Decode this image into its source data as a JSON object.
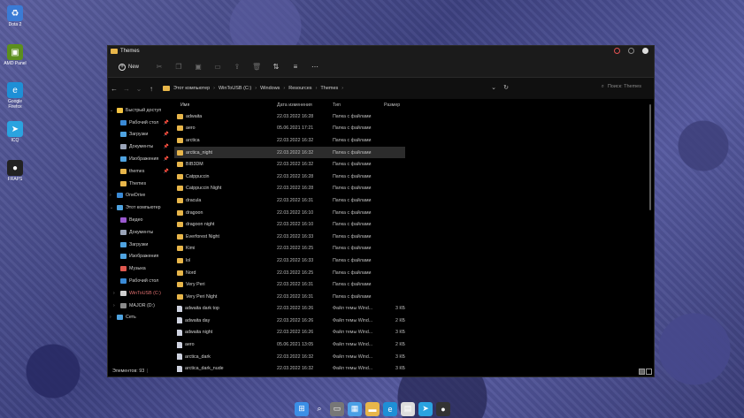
{
  "desktop": {
    "icons": [
      {
        "label": "Dota 2",
        "icon": "recycle-bin-icon",
        "color": "#3a7bd5"
      },
      {
        "label": "AMD Panel",
        "icon": "nvidia-icon",
        "color": "#5c8f1e"
      },
      {
        "label": "Google Firefox",
        "icon": "edge-icon",
        "color": "#1e8fd6"
      },
      {
        "label": "ICQ",
        "icon": "telegram-icon",
        "color": "#2aa3e0"
      },
      {
        "label": "FRAPS",
        "icon": "obs-icon",
        "color": "#222"
      }
    ]
  },
  "window": {
    "title": "Themes",
    "toolbar": {
      "new_label": "New",
      "new_icon": "plus-circle-icon"
    },
    "breadcrumb": [
      "Этот компьютер",
      "WinToUSB (C:)",
      "Windows",
      "Resources",
      "Themes"
    ],
    "search_placeholder": "Поиск: Themes",
    "columns": {
      "name": "Имя",
      "date": "Дата изменения",
      "type": "Тип",
      "size": "Размер"
    },
    "sidebar": [
      {
        "label": "Быстрый доступ",
        "icon": "star-icon",
        "color": "#f3c342",
        "caret": "⌄",
        "indent": 0
      },
      {
        "label": "Рабочий стол",
        "icon": "desktop-icon",
        "color": "#3a8ad6",
        "pin": true,
        "indent": 1
      },
      {
        "label": "Загрузки",
        "icon": "download-icon",
        "color": "#4fa3e0",
        "pin": true,
        "indent": 1
      },
      {
        "label": "Документы",
        "icon": "documents-icon",
        "color": "#9aa4b8",
        "pin": true,
        "indent": 1
      },
      {
        "label": "Изображения",
        "icon": "pictures-icon",
        "color": "#4fa3e0",
        "pin": true,
        "indent": 1
      },
      {
        "label": "themes",
        "icon": "folder-icon",
        "color": "#e8b64a",
        "pin": true,
        "indent": 1
      },
      {
        "label": "Themes",
        "icon": "folder-icon",
        "color": "#e8b64a",
        "indent": 1
      },
      {
        "label": "OneDrive",
        "icon": "cloud-icon",
        "color": "#3a8ad6",
        "caret": "›",
        "indent": 0
      },
      {
        "label": "Этот компьютер",
        "icon": "computer-icon",
        "color": "#4fa3e0",
        "caret": "⌄",
        "indent": 0
      },
      {
        "label": "Видео",
        "icon": "video-icon",
        "color": "#9b59d0",
        "indent": 1
      },
      {
        "label": "Документы",
        "icon": "documents-icon",
        "color": "#9aa4b8",
        "indent": 1
      },
      {
        "label": "Загрузки",
        "icon": "download-icon",
        "color": "#4fa3e0",
        "indent": 1
      },
      {
        "label": "Изображения",
        "icon": "pictures-icon",
        "color": "#4fa3e0",
        "indent": 1
      },
      {
        "label": "Музыка",
        "icon": "music-icon",
        "color": "#e0584f",
        "indent": 1
      },
      {
        "label": "Рабочий стол",
        "icon": "desktop-icon",
        "color": "#3a8ad6",
        "indent": 1
      },
      {
        "label": "WinToUSB (C:)",
        "icon": "drive-icon",
        "color": "#cfcfcf",
        "caret": "›",
        "indent": 1,
        "accent": true
      },
      {
        "label": "MAJOR (D:)",
        "icon": "drive-icon",
        "color": "#8a8a8a",
        "caret": "›",
        "indent": 1
      },
      {
        "label": "Сеть",
        "icon": "network-icon",
        "color": "#4fa3e0",
        "caret": "›",
        "indent": 0
      }
    ],
    "files": [
      {
        "name": "adwaita",
        "date": "22.03.2022 16:28",
        "type": "Папка с файлами",
        "size": "",
        "kind": "folder"
      },
      {
        "name": "aero",
        "date": "05.06.2021 17:21",
        "type": "Папка с файлами",
        "size": "",
        "kind": "folder"
      },
      {
        "name": "arctica",
        "date": "22.03.2022 16:32",
        "type": "Папка с файлами",
        "size": "",
        "kind": "folder"
      },
      {
        "name": "arctica_night",
        "date": "22.03.2022 16:32",
        "type": "Папка с файлами",
        "size": "",
        "kind": "folder",
        "selected": true
      },
      {
        "name": "BIB3DM",
        "date": "22.03.2022 16:32",
        "type": "Папка с файлами",
        "size": "",
        "kind": "folder"
      },
      {
        "name": "Catppuccin",
        "date": "22.03.2022 16:28",
        "type": "Папка с файлами",
        "size": "",
        "kind": "folder"
      },
      {
        "name": "Catppuccin Night",
        "date": "22.03.2022 16:28",
        "type": "Папка с файлами",
        "size": "",
        "kind": "folder"
      },
      {
        "name": "dracula",
        "date": "22.03.2022 16:31",
        "type": "Папка с файлами",
        "size": "",
        "kind": "folder"
      },
      {
        "name": "dragoon",
        "date": "22.03.2022 16:10",
        "type": "Папка с файлами",
        "size": "",
        "kind": "folder"
      },
      {
        "name": "dragoon night",
        "date": "22.03.2022 16:10",
        "type": "Папка с файлами",
        "size": "",
        "kind": "folder"
      },
      {
        "name": "Everforest Night",
        "date": "22.03.2022 16:33",
        "type": "Папка с файлами",
        "size": "",
        "kind": "folder"
      },
      {
        "name": "Kimi",
        "date": "22.03.2022 16:25",
        "type": "Папка с файлами",
        "size": "",
        "kind": "folder"
      },
      {
        "name": "lol",
        "date": "22.03.2022 16:33",
        "type": "Папка с файлами",
        "size": "",
        "kind": "folder"
      },
      {
        "name": "Nord",
        "date": "22.03.2022 16:25",
        "type": "Папка с файлами",
        "size": "",
        "kind": "folder"
      },
      {
        "name": "Very Peri",
        "date": "22.03.2022 16:31",
        "type": "Папка с файлами",
        "size": "",
        "kind": "folder"
      },
      {
        "name": "Very Peri Night",
        "date": "22.03.2022 16:31",
        "type": "Папка с файлами",
        "size": "",
        "kind": "folder"
      },
      {
        "name": "adwaita dark top",
        "date": "22.03.2022 16:26",
        "type": "Файл темы Wind...",
        "size": "3 КБ",
        "kind": "file"
      },
      {
        "name": "adwaita day",
        "date": "22.03.2022 16:26",
        "type": "Файл темы Wind...",
        "size": "2 КБ",
        "kind": "file"
      },
      {
        "name": "adwaita night",
        "date": "22.03.2022 16:26",
        "type": "Файл темы Wind...",
        "size": "3 КБ",
        "kind": "file"
      },
      {
        "name": "aero",
        "date": "05.06.2021 13:05",
        "type": "Файл темы Wind...",
        "size": "2 КБ",
        "kind": "file"
      },
      {
        "name": "arctica_dark",
        "date": "22.03.2022 16:32",
        "type": "Файл темы Wind...",
        "size": "3 КБ",
        "kind": "file"
      },
      {
        "name": "arctica_dark_nude",
        "date": "22.03.2022 16:32",
        "type": "Файл темы Wind...",
        "size": "3 КБ",
        "kind": "file"
      }
    ],
    "status": {
      "count_label": "Элементов: 93"
    }
  },
  "taskbar": [
    {
      "icon": "windows-start-icon",
      "color": "#3b8fe6",
      "glyph": "⊞"
    },
    {
      "icon": "search-icon",
      "color": "transparent",
      "glyph": "⌕"
    },
    {
      "icon": "task-view-icon",
      "color": "#777",
      "glyph": "▭"
    },
    {
      "icon": "widgets-icon",
      "color": "#4aa0e6",
      "glyph": "▦"
    },
    {
      "icon": "file-explorer-icon",
      "color": "#e8b64a",
      "glyph": "▬"
    },
    {
      "icon": "edge-icon",
      "color": "#1e8fd6",
      "glyph": "e"
    },
    {
      "icon": "calendar-icon",
      "color": "#ddd",
      "glyph": "▤"
    },
    {
      "icon": "telegram-icon",
      "color": "#2aa3e0",
      "glyph": "➤"
    },
    {
      "icon": "obs-icon",
      "color": "#333",
      "glyph": "●"
    }
  ]
}
